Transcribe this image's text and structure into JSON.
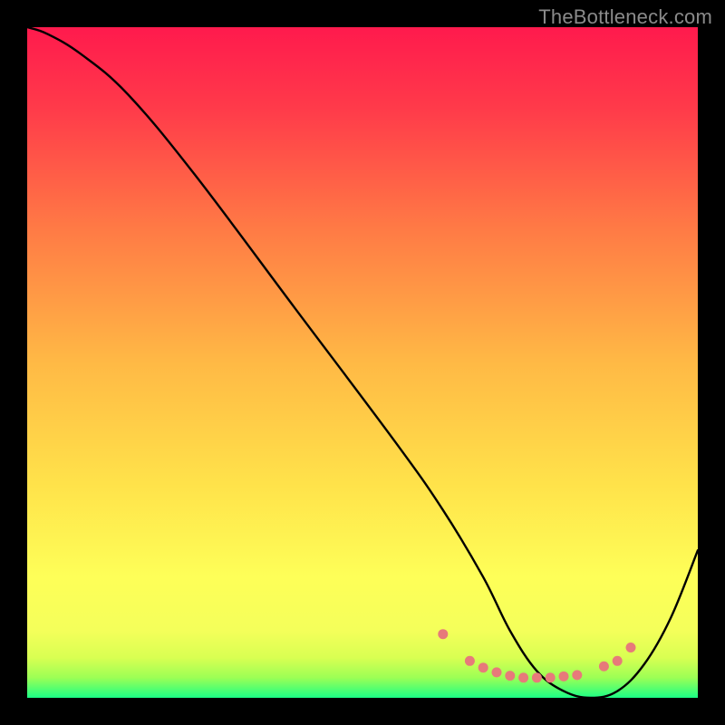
{
  "watermark": "TheBottleneck.com",
  "chart_data": {
    "type": "line",
    "title": "",
    "xlabel": "",
    "ylabel": "",
    "xlim": [
      0,
      100
    ],
    "ylim": [
      0,
      100
    ],
    "background_gradient": {
      "top_color": "#ff1a4d",
      "mid_color": "#ffd948",
      "bottom_colors": [
        "#feff66",
        "#d9ff52",
        "#7aff5a",
        "#1bff86"
      ]
    },
    "series": [
      {
        "name": "curve",
        "type": "line",
        "x": [
          0,
          3,
          8,
          15,
          25,
          40,
          55,
          62,
          68,
          72,
          76,
          80,
          84,
          88,
          92,
          96,
          100
        ],
        "y": [
          100,
          99,
          96,
          90,
          78,
          58,
          38,
          28,
          18,
          10,
          4,
          1,
          0,
          1,
          5,
          12,
          22
        ]
      },
      {
        "name": "dots",
        "type": "scatter",
        "x": [
          62,
          66,
          68,
          70,
          72,
          74,
          76,
          78,
          80,
          82,
          86,
          88,
          90
        ],
        "y": [
          9.5,
          5.5,
          4.5,
          3.8,
          3.3,
          3.0,
          3.0,
          3.0,
          3.2,
          3.4,
          4.7,
          5.5,
          7.5
        ],
        "color": "#e77a7a"
      }
    ]
  }
}
